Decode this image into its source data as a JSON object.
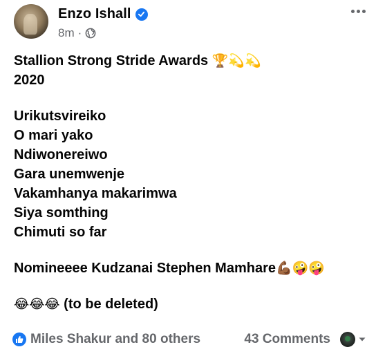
{
  "header": {
    "author_name": "Enzo Ishall",
    "time": "8m",
    "separator": "·",
    "icons": [
      "verified-badge-icon",
      "globe-icon",
      "more-options-icon"
    ]
  },
  "post": {
    "title_line": "Stallion Strong Stride Awards",
    "title_emoji": "🏆💫💫",
    "year": "2020",
    "songs": [
      "Urikutsvireiko",
      "O mari yako",
      "Ndiwonereiwo",
      "Gara unemwenje",
      "Vakamhanya makarimwa",
      "Siya somthing",
      "Chimuti so far"
    ],
    "nominee_line": "Nomineeee Kudzanai Stephen Mamhare",
    "nominee_emoji": "💪🏾🤪🤪",
    "closing_emoji": "😂😂😂",
    "closing_text": "(to be deleted)"
  },
  "footer": {
    "reactions_text": "Miles Shakur and 80 others",
    "comments_text": "43 Comments",
    "icons": [
      "like-reaction-icon",
      "viewer-avatar",
      "chevron-down-icon"
    ]
  },
  "colors": {
    "accent": "#1877f2",
    "secondary_text": "#65676b",
    "primary_text": "#050505"
  }
}
